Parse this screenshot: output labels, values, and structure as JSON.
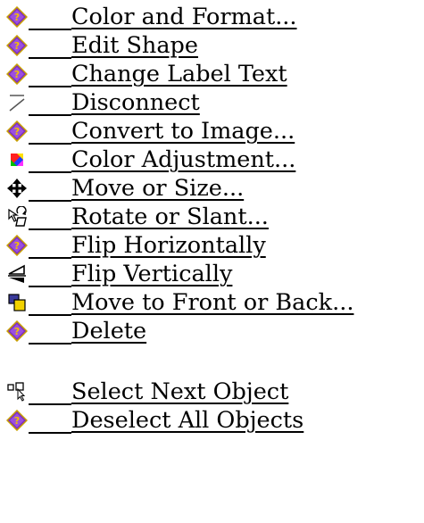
{
  "menu": {
    "items": [
      {
        "label": "Color and Format...",
        "icon": "diamond-help-icon"
      },
      {
        "label": "Edit Shape",
        "icon": "diamond-help-icon"
      },
      {
        "label": "Change Label Text",
        "icon": "diamond-help-icon"
      },
      {
        "label": "Disconnect",
        "icon": "disconnect-line-icon"
      },
      {
        "label": "Convert to Image...",
        "icon": "diamond-help-icon"
      },
      {
        "label": "Color Adjustment...",
        "icon": "color-adjust-icon"
      },
      {
        "label": "Move or Size...",
        "icon": "move-arrows-icon"
      },
      {
        "label": "Rotate or Slant...",
        "icon": "rotate-icon"
      },
      {
        "label": "Flip Horizontally",
        "icon": "diamond-help-icon"
      },
      {
        "label": "Flip Vertically",
        "icon": "flip-vertical-icon"
      },
      {
        "label": "Move to Front or Back...",
        "icon": "layer-order-icon"
      },
      {
        "label": "Delete",
        "icon": "diamond-help-icon"
      }
    ],
    "secondary_items": [
      {
        "label": "Select Next Object",
        "icon": "select-next-icon"
      },
      {
        "label": "Deselect All Objects",
        "icon": "diamond-help-icon"
      }
    ]
  },
  "colors": {
    "diamond_purple": "#7b2fbe",
    "diamond_gold": "#f2c200",
    "text": "#000000"
  }
}
